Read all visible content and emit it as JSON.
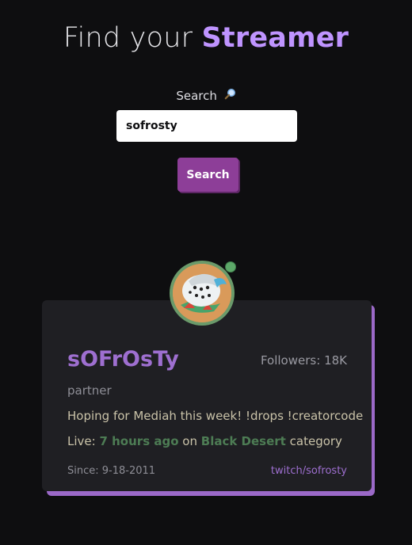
{
  "header": {
    "title_prefix": "Find your",
    "title_accent": "Streamer"
  },
  "search": {
    "label": "Search",
    "icon": "magnifier-icon",
    "value": "sofrosty",
    "button_label": "Search"
  },
  "streamer": {
    "display_name": "sOFrOsTy",
    "followers_label": "Followers:",
    "followers": "18K",
    "broadcaster_type": "partner",
    "stream_title": "Hoping for Mediah this week! !drops !creatorcode",
    "live_label": "Live:",
    "live_ago": "7 hours ago",
    "live_on": "on",
    "game": "Black Desert",
    "category_suffix": "category",
    "since_label": "Since:",
    "since_date": "9-18-2011",
    "channel_link": "twitch/sofrosty",
    "online": true
  },
  "colors": {
    "background": "#0e0e10",
    "accent": "#bf94ff",
    "button": "#8d3e98",
    "card": "#1f1f23",
    "card_shadow": "#9b69c8",
    "highlight_green": "#4d7c54"
  }
}
